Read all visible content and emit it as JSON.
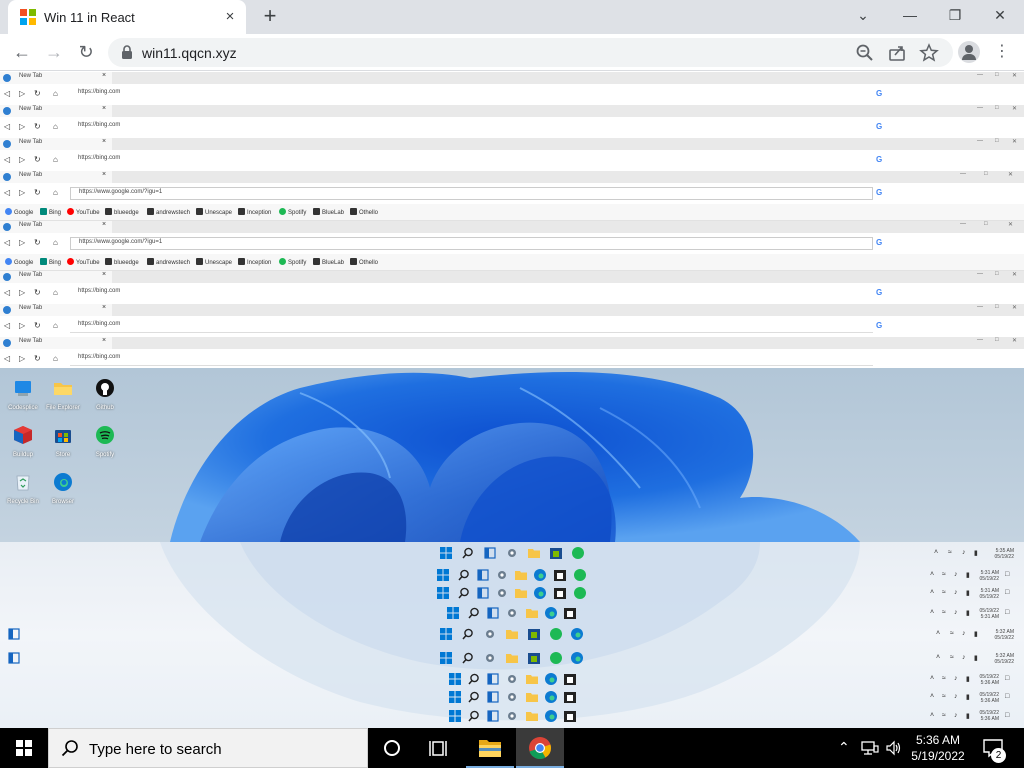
{
  "tab": {
    "title": "Win 11 in React",
    "close": "×",
    "new_tab": "+"
  },
  "window_controls": {
    "dropdown": "⌄",
    "minimize": "—",
    "restore": "❐",
    "close": "✕"
  },
  "toolbar": {
    "url": "win11.qqcn.xyz"
  },
  "nested": {
    "tab_title": "New Tab",
    "tab_close": "×",
    "url_bing": "https://bing.com",
    "url_google": "https://www.google.com/?igu=1",
    "g": "G",
    "bookmarks": [
      "Google",
      "Bing",
      "YouTube",
      "blueedge",
      "andrewstech",
      "Unescape",
      "Inception",
      "Spotify",
      "BlueLab",
      "Othello"
    ]
  },
  "desktop": {
    "icons": [
      {
        "label": "Codesplice"
      },
      {
        "label": "File Explorer"
      },
      {
        "label": "Github"
      },
      {
        "label": "Buildup"
      },
      {
        "label": "Store"
      },
      {
        "label": "Spotify"
      },
      {
        "label": "Recycle Bin"
      },
      {
        "label": "Browser"
      }
    ],
    "tray_times": [
      {
        "time": "5:35 AM",
        "date": "05/19/22"
      },
      {
        "time": "5:31 AM",
        "date": "05/19/22"
      },
      {
        "time": "5:31 AM",
        "date": "05/19/22"
      },
      {
        "time": "05/19/22",
        "date": "5:31 AM"
      },
      {
        "time": "5:32 AM",
        "date": "05/19/22"
      },
      {
        "time": "5:32 AM",
        "date": "05/19/22"
      },
      {
        "time": "05/19/22",
        "date": "5:36 AM"
      },
      {
        "time": "05/19/22",
        "date": "5:36 AM"
      },
      {
        "time": "05/19/22",
        "date": "5:36 AM"
      }
    ]
  },
  "taskbar": {
    "search_placeholder": "Type here to search",
    "clock_time": "5:36 AM",
    "clock_date": "5/19/2022",
    "notification_count": "2"
  },
  "colors": {
    "taskbar_bg": "#000000",
    "chrome_frame": "#dee1e6",
    "accent_blue": "#1a73e8",
    "bloom_blue": "#1f6fe0"
  }
}
